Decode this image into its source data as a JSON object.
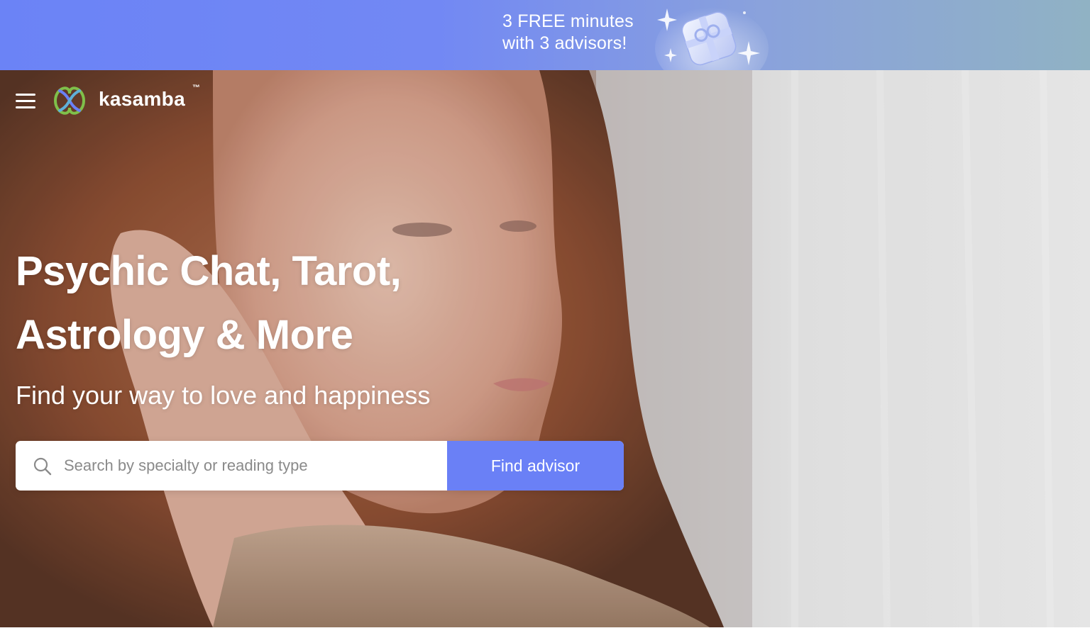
{
  "promo": {
    "line1": "3 FREE minutes",
    "line2": "with 3 advisors!",
    "art_icon": "gift-icon"
  },
  "nav": {
    "menu_icon": "hamburger-menu-icon",
    "logo_text": "kasamba",
    "logo_tm": "™"
  },
  "hero": {
    "headline_line1": "Psychic Chat, Tarot,",
    "headline_line2": "Astrology & More",
    "subheading": "Find your way to love and happiness"
  },
  "search": {
    "placeholder": "Search by specialty or reading type",
    "value": "",
    "button_label": "Find advisor",
    "icon": "search-icon"
  },
  "colors": {
    "accent": "#6a80f6",
    "banner_start": "#6b83f6",
    "banner_end": "#90b2c4"
  }
}
